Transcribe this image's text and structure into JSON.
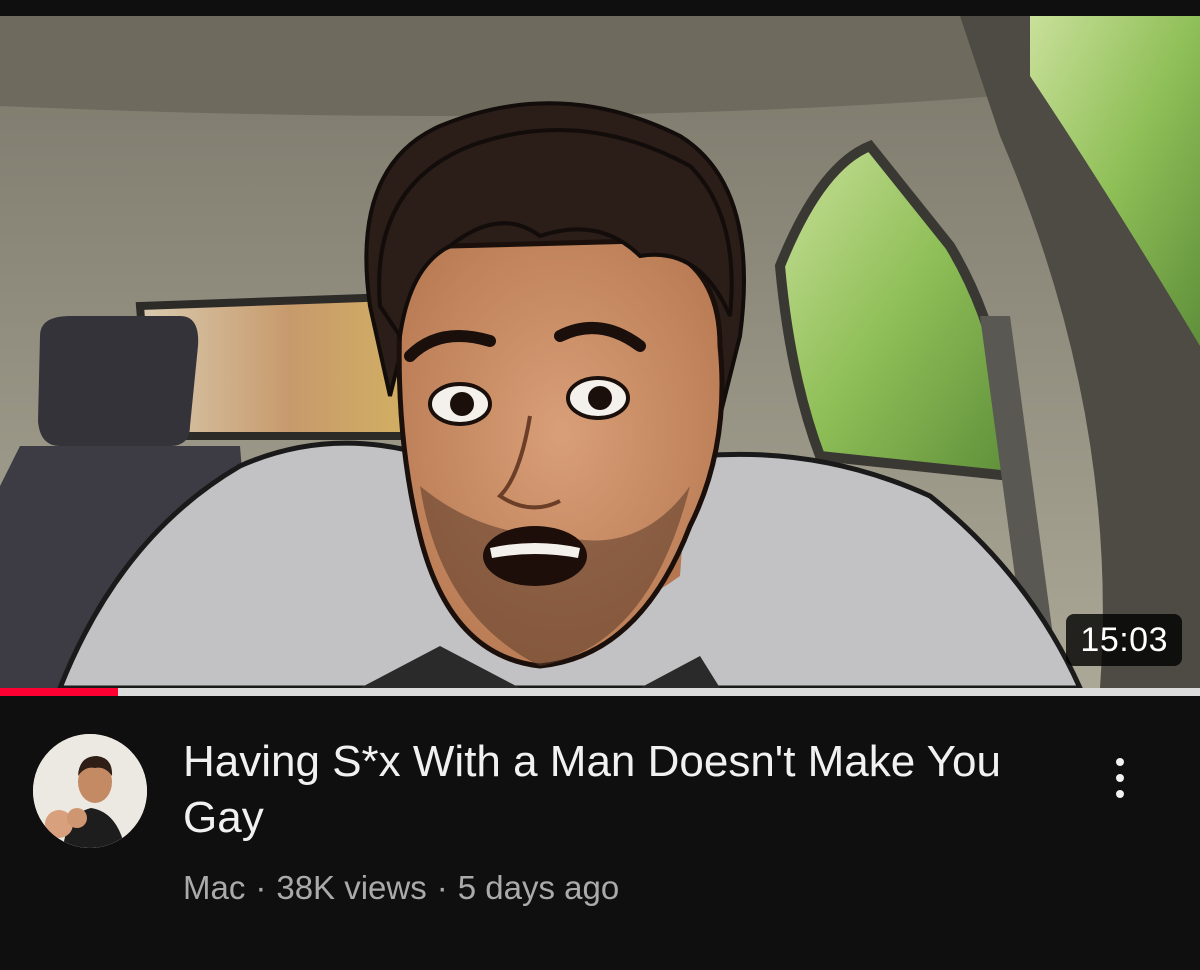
{
  "video": {
    "duration": "15:03",
    "progress_fraction": 0.098,
    "title": "Having S*x With a Man Doesn't Make You Gay",
    "channel": "Mac",
    "views": "38K views",
    "age": "5 days ago",
    "separator": "·"
  },
  "colors": {
    "background": "#0f0f0f",
    "progress": "#ff0033",
    "title_text": "#f1f1f1",
    "meta_text": "#aaaaaa"
  },
  "icons": {
    "more": "more-vert-icon"
  }
}
